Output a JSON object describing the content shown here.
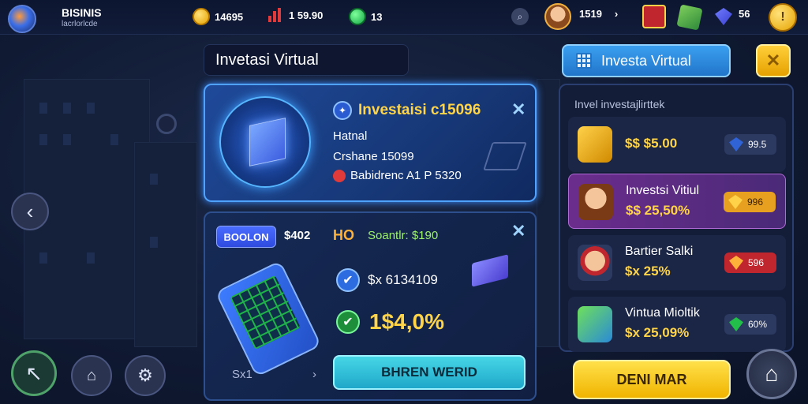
{
  "topbar": {
    "brand": "BISINIS",
    "brand_sub": "lacrlorlcde",
    "coins": "14695",
    "stock": "1 59.90",
    "gems": "13",
    "level": "1519",
    "level_suffix": "›",
    "blue_gems": "56"
  },
  "main": {
    "title": "Invetasi Virtual",
    "card1": {
      "title": "Investaisi c15096",
      "line1": "Hatnal",
      "line2": "Crshane 15099",
      "line3": "Babidrenc A1 P 5320"
    },
    "card2": {
      "badge": "BOOLON",
      "price": "$402",
      "prefix": "HO",
      "stat": "Soantlr: $190",
      "row1": "$x 6134109",
      "row2": "1$4,0%",
      "foot_left": "Sx1",
      "foot_mid": "›",
      "button": "BHREN WERID"
    }
  },
  "right": {
    "header": "Investa Virtual",
    "label": "Invel investajlirttek",
    "items": [
      {
        "name": "",
        "value": "$$ $5.00",
        "chip": "99.5",
        "icon": "phone-icon",
        "color": "#2f63d6"
      },
      {
        "name": "Investsi Vitiul",
        "value": "$$ 25,50%",
        "chip": "996",
        "icon": "girl-avatar-icon",
        "color": "#e0a030"
      },
      {
        "name": "Bartier Salki",
        "value": "$x 25%",
        "chip": "596",
        "icon": "boy-avatar-icon",
        "color": "#e0a030"
      },
      {
        "name": "Vintua Mioltik",
        "value": "$x 25,09%",
        "chip": "60%",
        "icon": "gem-box-icon",
        "color": "#22c04a"
      }
    ],
    "button": "DENI MAR"
  },
  "colors": {
    "accent_gold": "#ffd447",
    "panel_blue": "#173878",
    "active_purple": "#6b2d8c"
  }
}
